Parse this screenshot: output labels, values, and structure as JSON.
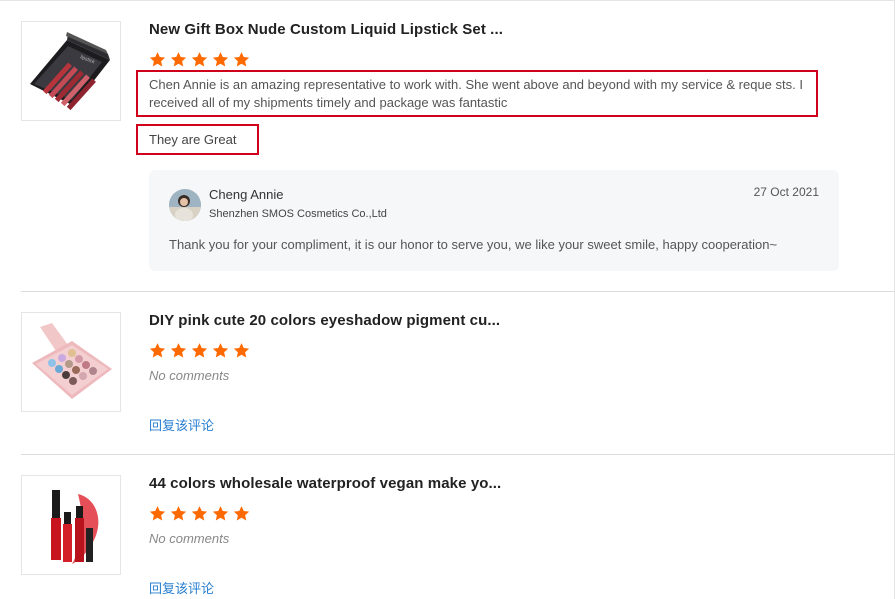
{
  "colors": {
    "star": "#ff6a00",
    "highlight": "#d0021b",
    "link": "#2a7fd0"
  },
  "reviews": [
    {
      "product_title": "New Gift Box Nude Custom Liquid Lipstick Set ...",
      "rating": 5,
      "comment": "Chen Annie is an amazing representative to work with. She went above and beyond with my service & reque sts.  I received all of my shipments timely and package was fantastic",
      "extra_comment": "They are Great",
      "reply": {
        "name": "Cheng Annie",
        "company": "Shenzhen SMOS Cosmetics Co.,Ltd",
        "date": "27 Oct 2021",
        "text": "Thank you for your compliment, it is our honor to serve you, we like your sweet smile, happy cooperation~"
      }
    },
    {
      "product_title": "DIY pink cute 20 colors eyeshadow pigment cu...",
      "rating": 5,
      "comment": "No comments",
      "reply_link": "回复该评论"
    },
    {
      "product_title": "44 colors wholesale waterproof vegan make yo...",
      "rating": 5,
      "comment": "No comments",
      "reply_link": "回复该评论"
    }
  ]
}
